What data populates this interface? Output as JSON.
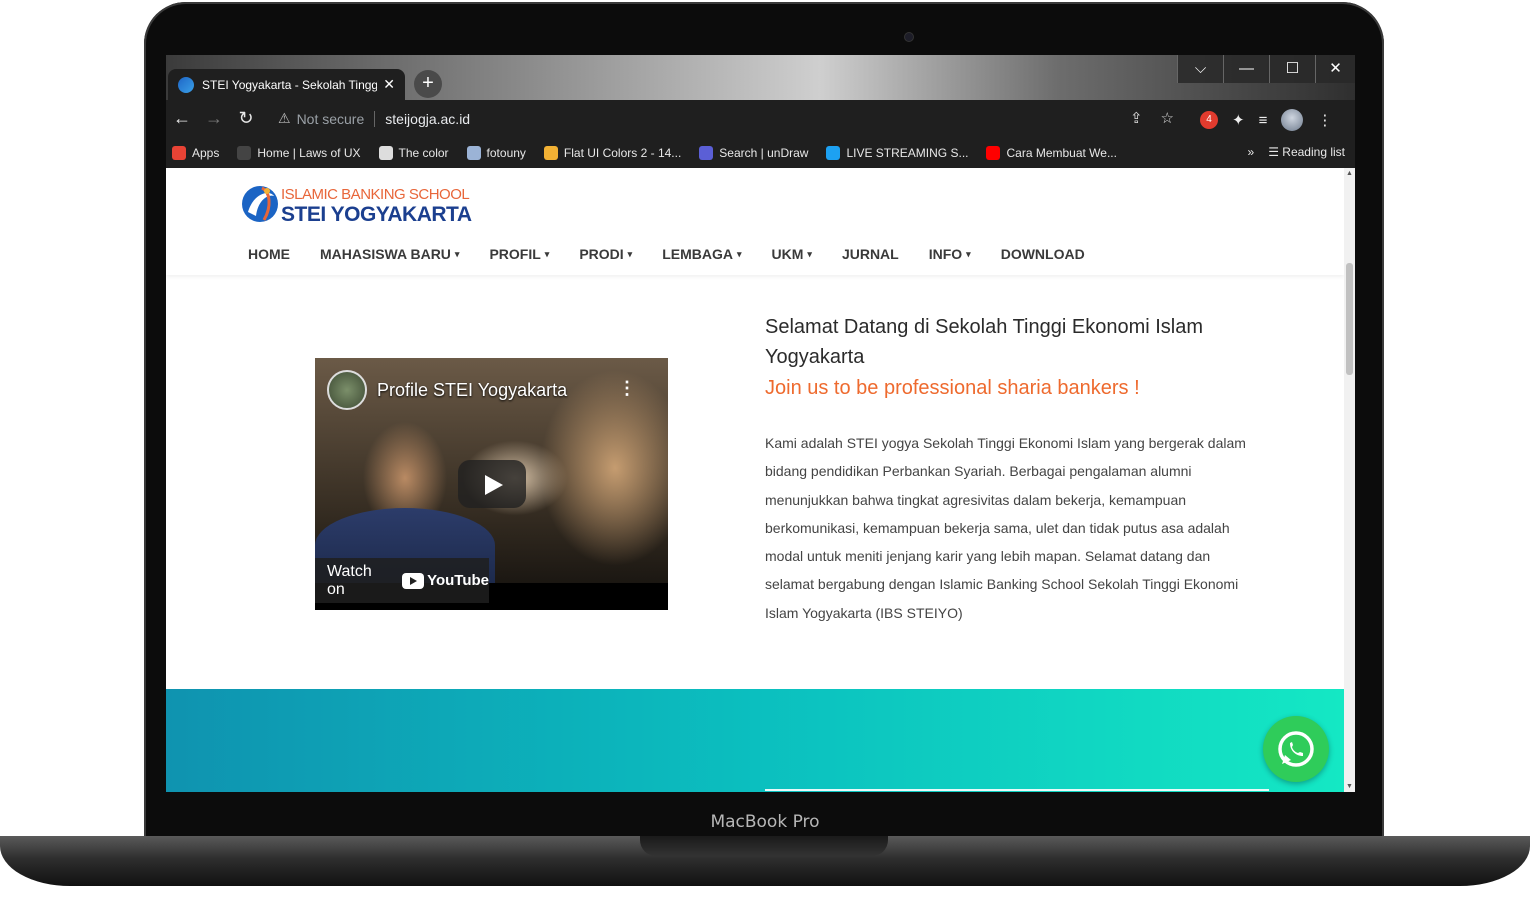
{
  "device": {
    "label": "MacBook Pro"
  },
  "browser": {
    "tab": {
      "title": "STEI Yogyakarta - Sekolah Tinggi Ekonomi Islam Yogyakarta",
      "close": "✕"
    },
    "new_tab": "+",
    "window_controls": {
      "dropdown": "⌵",
      "minimize": "—",
      "maximize": "☐",
      "close": "✕"
    },
    "nav": {
      "back": "←",
      "forward": "→",
      "reload": "↻"
    },
    "address": {
      "warning_icon": "⚠",
      "security": "Not secure",
      "url": "steijogja.ac.id"
    },
    "extension_badge": "4",
    "bookmarks": [
      {
        "label": "Apps",
        "color": "#e84335"
      },
      {
        "label": "Home | Laws of UX",
        "color": "#444444"
      },
      {
        "label": "The color",
        "color": "#dddddd"
      },
      {
        "label": "fotouny",
        "color": "#9bb3d6"
      },
      {
        "label": "Flat UI Colors 2 - 14...",
        "color": "#f2b134"
      },
      {
        "label": "Search | unDraw",
        "color": "#5b5fd6"
      },
      {
        "label": "LIVE STREAMING S...",
        "color": "#1da1f2"
      },
      {
        "label": "Cara Membuat We...",
        "color": "#ff0000"
      }
    ],
    "bookmarks_more": "»",
    "reading_list": "Reading list"
  },
  "site": {
    "logo": {
      "top": "ISLAMIC BANKING SCHOOL",
      "bottom": "STEI YOGYAKARTA"
    },
    "menu": [
      {
        "label": "HOME",
        "dropdown": false
      },
      {
        "label": "MAHASISWA BARU",
        "dropdown": true
      },
      {
        "label": "PROFIL",
        "dropdown": true
      },
      {
        "label": "PRODI",
        "dropdown": true
      },
      {
        "label": "LEMBAGA",
        "dropdown": true
      },
      {
        "label": "UKM",
        "dropdown": true
      },
      {
        "label": "JURNAL",
        "dropdown": false
      },
      {
        "label": "INFO",
        "dropdown": true
      },
      {
        "label": "DOWNLOAD",
        "dropdown": false
      }
    ],
    "caret": "▾",
    "video": {
      "title": "Profile STEI Yogyakarta",
      "menu": "⋮",
      "watch_on": "Watch on",
      "youtube": "YouTube"
    },
    "welcome_title": "Selamat Datang di Sekolah Tinggi Ekonomi Islam Yogyakarta",
    "tagline": "Join us to be professional sharia bankers !",
    "about": "Kami adalah STEI yogya Sekolah Tinggi Ekonomi Islam yang bergerak dalam bidang pendidikan Perbankan Syariah. Berbagai pengalaman alumni menunjukkan bahwa tingkat agresivitas dalam bekerja, kemampuan berkomunikasi, kemampuan bekerja sama, ulet dan tidak putus asa adalah modal untuk meniti jenjang karir yang lebih mapan. Selamat datang dan selamat bergabung dengan Islamic Banking School Sekolah Tinggi Ekonomi Islam Yogyakarta (IBS STEIYO)"
  },
  "colors": {
    "accent_orange": "#ee6a2e",
    "brand_blue": "#1b3f8f",
    "whatsapp_green": "#2fcc5a"
  }
}
